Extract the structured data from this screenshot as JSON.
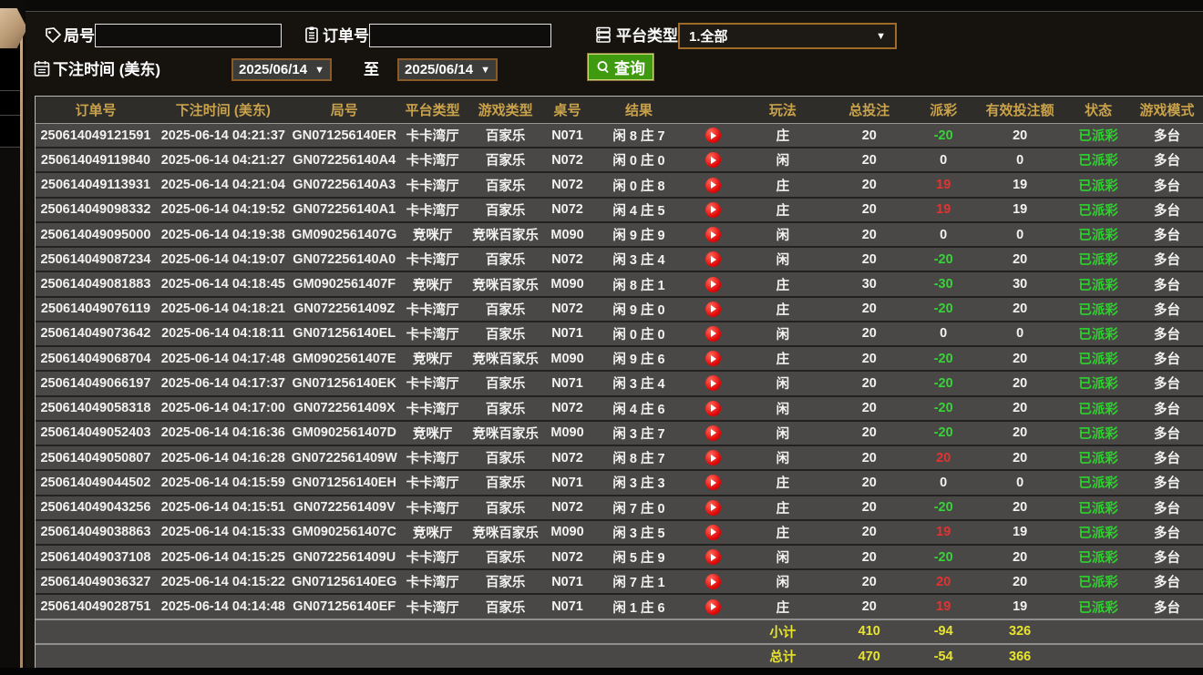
{
  "filters": {
    "game_no_label": "局号",
    "order_no_label": "订单号",
    "platform_label": "平台类型",
    "platform_value": "1.全部",
    "bet_time_label": "下注时间 (美东)",
    "date_from": "2025/06/14",
    "date_to": "2025/06/14",
    "to_label": "至",
    "search_label": "查询",
    "dropdown_arrow": "▼"
  },
  "colors": {
    "accent_gold": "#c9a24b",
    "payout_positive": "#e23333",
    "payout_negative": "#3ad23a",
    "status_green": "#2ed22e",
    "total_yellow": "#e8e42e",
    "button_green": "#3f9a10"
  },
  "table": {
    "headers": [
      "订单号",
      "下注时间 (美东)",
      "局号",
      "平台类型",
      "游戏类型",
      "桌号",
      "结果",
      "",
      "玩法",
      "总投注",
      "派彩",
      "有效投注额",
      "状态",
      "游戏模式"
    ],
    "rows": [
      {
        "order_no": "250614049121591",
        "bet_time": "2025-06-14 04:21:37",
        "game_no": "GN071256140ER",
        "platform": "卡卡湾厅",
        "game_type": "百家乐",
        "table_no": "N071",
        "result": "闲 8 庄 7",
        "play": "庄",
        "total_bet": "20",
        "payout": "-20",
        "payout_class": "neg",
        "valid_bet": "20",
        "status": "已派彩",
        "mode": "多台"
      },
      {
        "order_no": "250614049119840",
        "bet_time": "2025-06-14 04:21:27",
        "game_no": "GN072256140A4",
        "platform": "卡卡湾厅",
        "game_type": "百家乐",
        "table_no": "N072",
        "result": "闲 0 庄 0",
        "play": "闲",
        "total_bet": "20",
        "payout": "0",
        "payout_class": "zero",
        "valid_bet": "0",
        "status": "已派彩",
        "mode": "多台"
      },
      {
        "order_no": "250614049113931",
        "bet_time": "2025-06-14 04:21:04",
        "game_no": "GN072256140A3",
        "platform": "卡卡湾厅",
        "game_type": "百家乐",
        "table_no": "N072",
        "result": "闲 0 庄 8",
        "play": "庄",
        "total_bet": "20",
        "payout": "19",
        "payout_class": "pos",
        "valid_bet": "19",
        "status": "已派彩",
        "mode": "多台"
      },
      {
        "order_no": "250614049098332",
        "bet_time": "2025-06-14 04:19:52",
        "game_no": "GN072256140A1",
        "platform": "卡卡湾厅",
        "game_type": "百家乐",
        "table_no": "N072",
        "result": "闲 4 庄 5",
        "play": "庄",
        "total_bet": "20",
        "payout": "19",
        "payout_class": "pos",
        "valid_bet": "19",
        "status": "已派彩",
        "mode": "多台"
      },
      {
        "order_no": "250614049095000",
        "bet_time": "2025-06-14 04:19:38",
        "game_no": "GM0902561407G",
        "platform": "竞咪厅",
        "game_type": "竞咪百家乐",
        "table_no": "M090",
        "result": "闲 9 庄 9",
        "play": "闲",
        "total_bet": "20",
        "payout": "0",
        "payout_class": "zero",
        "valid_bet": "0",
        "status": "已派彩",
        "mode": "多台"
      },
      {
        "order_no": "250614049087234",
        "bet_time": "2025-06-14 04:19:07",
        "game_no": "GN072256140A0",
        "platform": "卡卡湾厅",
        "game_type": "百家乐",
        "table_no": "N072",
        "result": "闲 3 庄 4",
        "play": "闲",
        "total_bet": "20",
        "payout": "-20",
        "payout_class": "neg",
        "valid_bet": "20",
        "status": "已派彩",
        "mode": "多台"
      },
      {
        "order_no": "250614049081883",
        "bet_time": "2025-06-14 04:18:45",
        "game_no": "GM0902561407F",
        "platform": "竞咪厅",
        "game_type": "竞咪百家乐",
        "table_no": "M090",
        "result": "闲 8 庄 1",
        "play": "庄",
        "total_bet": "30",
        "payout": "-30",
        "payout_class": "neg",
        "valid_bet": "30",
        "status": "已派彩",
        "mode": "多台"
      },
      {
        "order_no": "250614049076119",
        "bet_time": "2025-06-14 04:18:21",
        "game_no": "GN0722561409Z",
        "platform": "卡卡湾厅",
        "game_type": "百家乐",
        "table_no": "N072",
        "result": "闲 9 庄 0",
        "play": "庄",
        "total_bet": "20",
        "payout": "-20",
        "payout_class": "neg",
        "valid_bet": "20",
        "status": "已派彩",
        "mode": "多台"
      },
      {
        "order_no": "250614049073642",
        "bet_time": "2025-06-14 04:18:11",
        "game_no": "GN071256140EL",
        "platform": "卡卡湾厅",
        "game_type": "百家乐",
        "table_no": "N071",
        "result": "闲 0 庄 0",
        "play": "闲",
        "total_bet": "20",
        "payout": "0",
        "payout_class": "zero",
        "valid_bet": "0",
        "status": "已派彩",
        "mode": "多台"
      },
      {
        "order_no": "250614049068704",
        "bet_time": "2025-06-14 04:17:48",
        "game_no": "GM0902561407E",
        "platform": "竞咪厅",
        "game_type": "竞咪百家乐",
        "table_no": "M090",
        "result": "闲 9 庄 6",
        "play": "庄",
        "total_bet": "20",
        "payout": "-20",
        "payout_class": "neg",
        "valid_bet": "20",
        "status": "已派彩",
        "mode": "多台"
      },
      {
        "order_no": "250614049066197",
        "bet_time": "2025-06-14 04:17:37",
        "game_no": "GN071256140EK",
        "platform": "卡卡湾厅",
        "game_type": "百家乐",
        "table_no": "N071",
        "result": "闲 3 庄 4",
        "play": "闲",
        "total_bet": "20",
        "payout": "-20",
        "payout_class": "neg",
        "valid_bet": "20",
        "status": "已派彩",
        "mode": "多台"
      },
      {
        "order_no": "250614049058318",
        "bet_time": "2025-06-14 04:17:00",
        "game_no": "GN0722561409X",
        "platform": "卡卡湾厅",
        "game_type": "百家乐",
        "table_no": "N072",
        "result": "闲 4 庄 6",
        "play": "闲",
        "total_bet": "20",
        "payout": "-20",
        "payout_class": "neg",
        "valid_bet": "20",
        "status": "已派彩",
        "mode": "多台"
      },
      {
        "order_no": "250614049052403",
        "bet_time": "2025-06-14 04:16:36",
        "game_no": "GM0902561407D",
        "platform": "竞咪厅",
        "game_type": "竞咪百家乐",
        "table_no": "M090",
        "result": "闲 3 庄 7",
        "play": "闲",
        "total_bet": "20",
        "payout": "-20",
        "payout_class": "neg",
        "valid_bet": "20",
        "status": "已派彩",
        "mode": "多台"
      },
      {
        "order_no": "250614049050807",
        "bet_time": "2025-06-14 04:16:28",
        "game_no": "GN0722561409W",
        "platform": "卡卡湾厅",
        "game_type": "百家乐",
        "table_no": "N072",
        "result": "闲 8 庄 7",
        "play": "闲",
        "total_bet": "20",
        "payout": "20",
        "payout_class": "pos",
        "valid_bet": "20",
        "status": "已派彩",
        "mode": "多台"
      },
      {
        "order_no": "250614049044502",
        "bet_time": "2025-06-14 04:15:59",
        "game_no": "GN071256140EH",
        "platform": "卡卡湾厅",
        "game_type": "百家乐",
        "table_no": "N071",
        "result": "闲 3 庄 3",
        "play": "庄",
        "total_bet": "20",
        "payout": "0",
        "payout_class": "zero",
        "valid_bet": "0",
        "status": "已派彩",
        "mode": "多台"
      },
      {
        "order_no": "250614049043256",
        "bet_time": "2025-06-14 04:15:51",
        "game_no": "GN0722561409V",
        "platform": "卡卡湾厅",
        "game_type": "百家乐",
        "table_no": "N072",
        "result": "闲 7 庄 0",
        "play": "庄",
        "total_bet": "20",
        "payout": "-20",
        "payout_class": "neg",
        "valid_bet": "20",
        "status": "已派彩",
        "mode": "多台"
      },
      {
        "order_no": "250614049038863",
        "bet_time": "2025-06-14 04:15:33",
        "game_no": "GM0902561407C",
        "platform": "竞咪厅",
        "game_type": "竞咪百家乐",
        "table_no": "M090",
        "result": "闲 3 庄 5",
        "play": "庄",
        "total_bet": "20",
        "payout": "19",
        "payout_class": "pos",
        "valid_bet": "19",
        "status": "已派彩",
        "mode": "多台"
      },
      {
        "order_no": "250614049037108",
        "bet_time": "2025-06-14 04:15:25",
        "game_no": "GN0722561409U",
        "platform": "卡卡湾厅",
        "game_type": "百家乐",
        "table_no": "N072",
        "result": "闲 5 庄 9",
        "play": "闲",
        "total_bet": "20",
        "payout": "-20",
        "payout_class": "neg",
        "valid_bet": "20",
        "status": "已派彩",
        "mode": "多台"
      },
      {
        "order_no": "250614049036327",
        "bet_time": "2025-06-14 04:15:22",
        "game_no": "GN071256140EG",
        "platform": "卡卡湾厅",
        "game_type": "百家乐",
        "table_no": "N071",
        "result": "闲 7 庄 1",
        "play": "闲",
        "total_bet": "20",
        "payout": "20",
        "payout_class": "pos",
        "valid_bet": "20",
        "status": "已派彩",
        "mode": "多台"
      },
      {
        "order_no": "250614049028751",
        "bet_time": "2025-06-14 04:14:48",
        "game_no": "GN071256140EF",
        "platform": "卡卡湾厅",
        "game_type": "百家乐",
        "table_no": "N071",
        "result": "闲 1 庄 6",
        "play": "庄",
        "total_bet": "20",
        "payout": "19",
        "payout_class": "pos",
        "valid_bet": "19",
        "status": "已派彩",
        "mode": "多台"
      }
    ],
    "subtotal": {
      "label": "小计",
      "total_bet": "410",
      "payout": "-94",
      "valid_bet": "326"
    },
    "total": {
      "label": "总计",
      "total_bet": "470",
      "payout": "-54",
      "valid_bet": "366"
    }
  }
}
